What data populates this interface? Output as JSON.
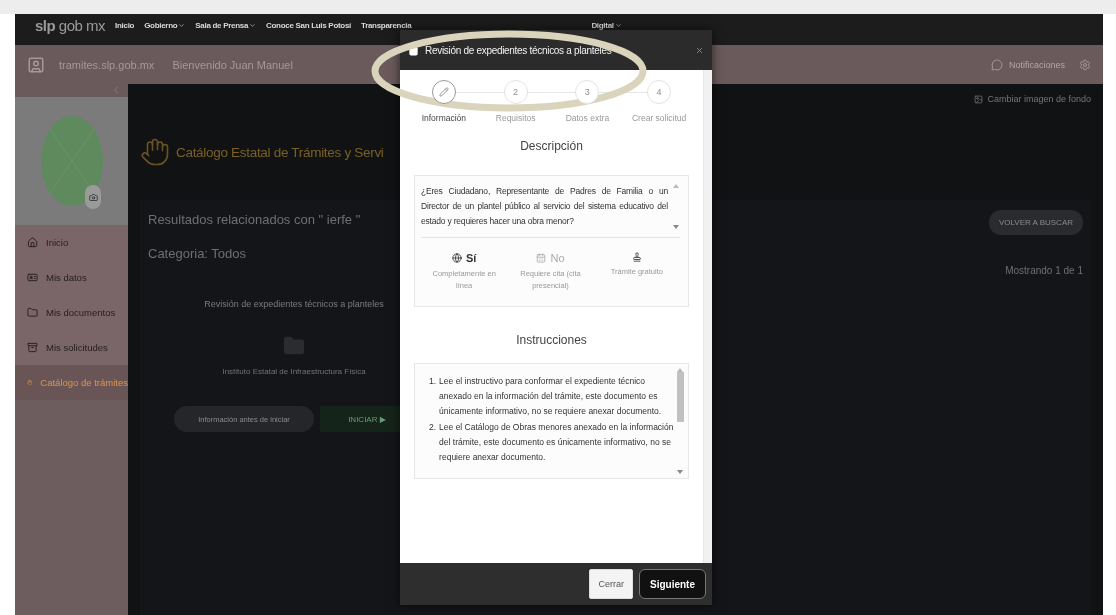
{
  "top_nav": {
    "logo_bold": "slp",
    "logo_light": "gob mx",
    "items": [
      {
        "label": "Inicio",
        "dropdown": false
      },
      {
        "label": "Gobierno",
        "dropdown": true
      },
      {
        "label": "Sala de Prensa",
        "dropdown": true
      },
      {
        "label": "Conoce San Luis Potosí",
        "dropdown": false
      },
      {
        "label": "Transparencia",
        "dropdown": false
      },
      {
        "label": "Digital",
        "dropdown": true
      }
    ]
  },
  "header_bar": {
    "site": "tramites.slp.gob.mx",
    "welcome": "Bienvenido Juan Manuel",
    "notifications": "Notificaciones"
  },
  "sidebar": {
    "items": [
      {
        "label": "Inicio",
        "kind": "home",
        "selected": false
      },
      {
        "label": "Mis datos",
        "kind": "id",
        "selected": false
      },
      {
        "label": "Mis documentos",
        "kind": "folder",
        "selected": false
      },
      {
        "label": "Mis solicitudes",
        "kind": "archive",
        "selected": false
      },
      {
        "label": "Catálogo de trámites",
        "kind": "hand",
        "selected": true
      }
    ]
  },
  "content": {
    "title": "Catálogo Estatal de Trámites y Servi",
    "change_background": "Cambiar imagen de fondo",
    "results": "Resultados relacionados con \" ierfe \"",
    "category": "Categoria: Todos",
    "back_button": "VOLVER A BUSCAR",
    "showing": "Mostrando 1 de 1",
    "card": {
      "title": "Revisión de expedientes técnicos a planteles",
      "agency": "Instituto Estatal de Infraestructura Física",
      "info_button": "Información antes de iniciar",
      "start_button": "INICIAR ▶"
    }
  },
  "modal": {
    "title": "Revisión de expedientes técnicos a planteles",
    "steps": [
      {
        "label": "Información",
        "selected": true
      },
      {
        "number": "2",
        "label": "Requisitos",
        "selected": false
      },
      {
        "number": "3",
        "label": "Datos extra",
        "selected": false
      },
      {
        "number": "4",
        "label": "Crear solicitud",
        "selected": false
      }
    ],
    "description_heading": "Descripción",
    "description": "¿Eres Ciudadano, Representante de Padres de Familia o un Director de un plantel público al servicio del sistema educativo del estado y requieres hacer una obra menor?",
    "features": [
      {
        "kind": "online",
        "value": "Sí",
        "caption": "Completamente en línea",
        "on": true
      },
      {
        "kind": "appointment",
        "value": "No",
        "caption": "Requiere cita (cita presencial)",
        "on": false
      },
      {
        "kind": "free",
        "caption": "Trámite gratuito",
        "on": true
      }
    ],
    "instructions_heading": "Instrucciones",
    "instructions": [
      {
        "number": "1.",
        "text": "Lee el instructivo para conformar el expediente técnico anexado en la información del trámite, este documento es únicamente informativo, no se requiere anexar documento."
      },
      {
        "number": "2.",
        "text": "Lee el Catálogo de Obras menores anexado en la información del trámite, este documento es únicamente informativo, no se requiere anexar documento."
      }
    ],
    "close_button": "Cerrar",
    "next_button": "Siguiente"
  }
}
